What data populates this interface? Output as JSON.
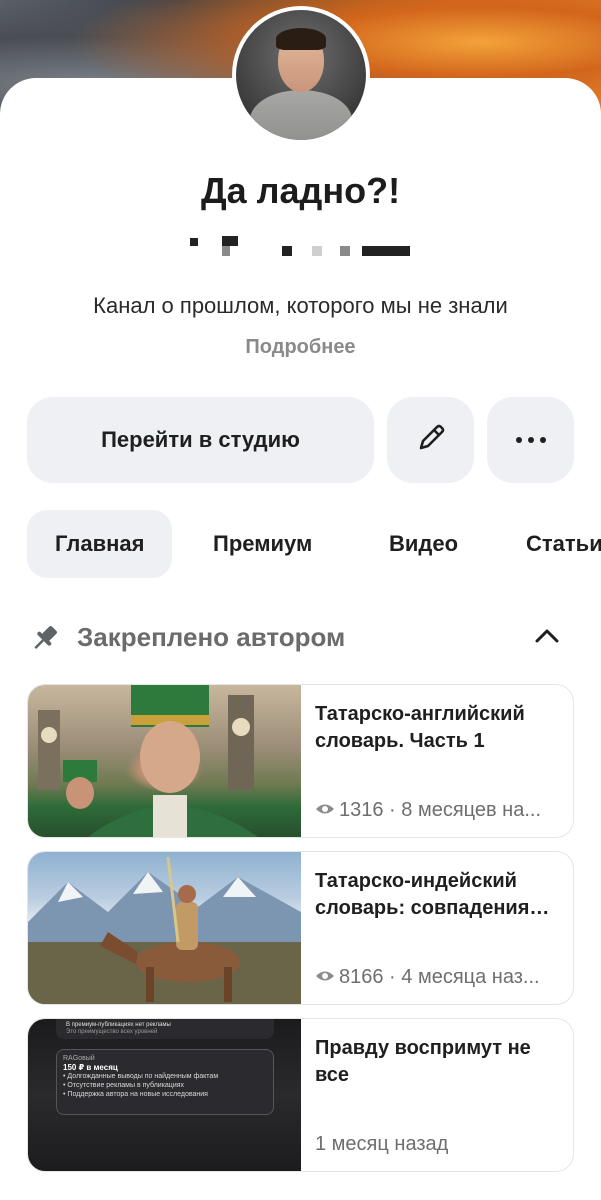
{
  "channel": {
    "title": "Да ладно?!",
    "description": "Канал о прошлом, которого мы не знали",
    "more_label": "Подробнее"
  },
  "actions": {
    "studio_label": "Перейти в студию",
    "edit_icon": "pencil-icon",
    "more_icon": "more-dots-icon"
  },
  "tabs": [
    {
      "label": "Главная",
      "active": true
    },
    {
      "label": "Премиум",
      "active": false
    },
    {
      "label": "Видео",
      "active": false
    },
    {
      "label": "Статьи",
      "active": false
    }
  ],
  "pinned": {
    "label": "Закреплено автором",
    "collapse_icon": "chevron-up-icon"
  },
  "posts": [
    {
      "title": "Татарско-английский словарь. Часть 1",
      "views": "1316",
      "age": "8 месяцев назад",
      "meta": "1316 · 8 месяцев на..."
    },
    {
      "title": "Татарско-индейский словарь: совпадения…",
      "views": "8166",
      "age": "4 месяца назад",
      "meta": "8166 · 4 месяца наз..."
    },
    {
      "title": "Правду воспримут не все",
      "age": "1 месяц назад",
      "meta": "1 месяц назад"
    }
  ],
  "premium_thumb": {
    "top_line": "В премиум-публикациях нет рекламы",
    "top_sub": "Это преимущество всех уровней",
    "tier_name": "RAGовый",
    "price": "150 ₽ в месяц",
    "perks": [
      "Долгожданные выводы по найденным фактам",
      "Отсутствие рекламы в публикациях",
      "Поддержка автора на новые исследования"
    ]
  },
  "colors": {
    "button_bg": "#eef0f3",
    "muted_text": "#8a8a8a",
    "text": "#1f1f1f"
  }
}
